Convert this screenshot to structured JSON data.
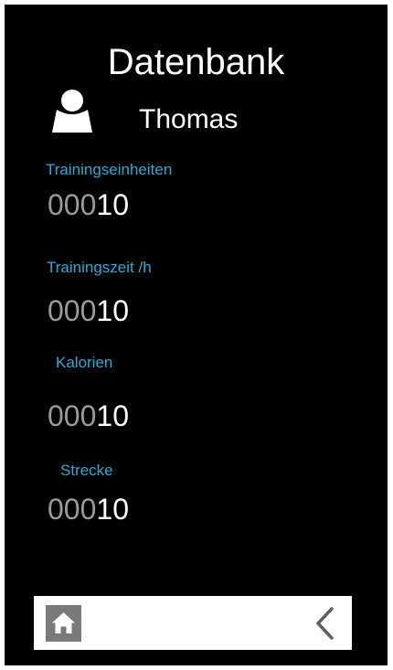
{
  "header": {
    "title": "Datenbank"
  },
  "user": {
    "name": "Thomas",
    "icon": "user-icon"
  },
  "stats": [
    {
      "label": "Trainingseinheiten",
      "value_lead": "000",
      "value_main": "10"
    },
    {
      "label": "Trainingszeit /h",
      "value_lead": "000",
      "value_main": "10"
    },
    {
      "label": "Kalorien",
      "value_lead": "000",
      "value_main": "10"
    },
    {
      "label": "Strecke",
      "value_lead": "000",
      "value_main": "10"
    }
  ],
  "nav": {
    "home_icon": "home-icon",
    "back_icon": "chevron-left-icon"
  },
  "colors": {
    "background": "#000000",
    "label_accent": "#31a9d4",
    "value_leading_zeros": "#9a9a9a",
    "value_text": "#ffffff",
    "nav_bar": "#ffffff",
    "home_button": "#7a7a7a",
    "back_icon": "#5f5f5f"
  }
}
